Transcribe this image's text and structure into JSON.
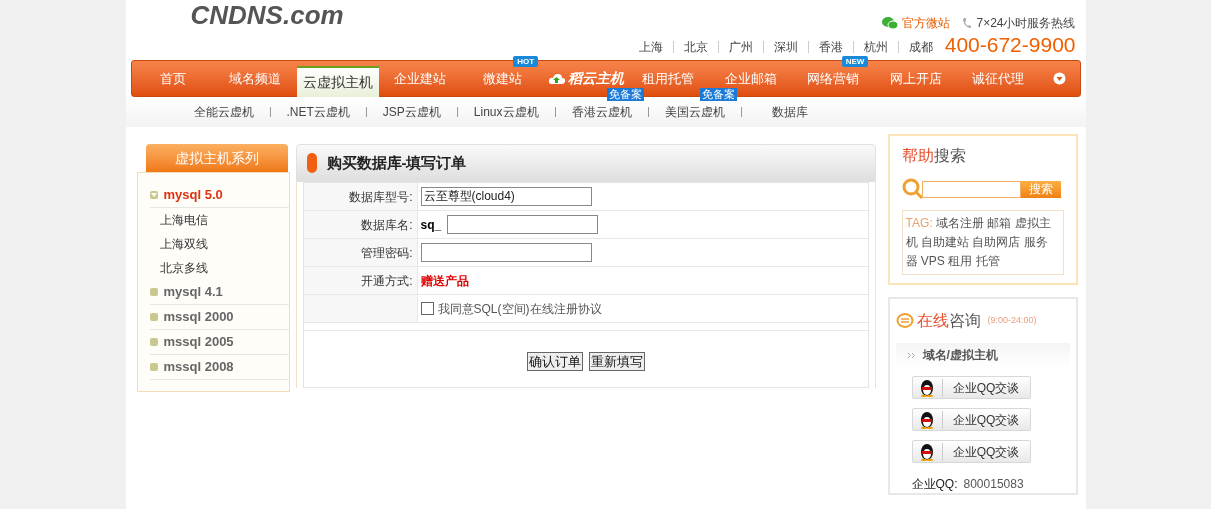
{
  "header": {
    "logo": "CNDNS.com",
    "wechat": "官方微站",
    "hotline": "7×24小时服务热线",
    "cities": [
      "上海",
      "北京",
      "广州",
      "深圳",
      "香港",
      "杭州",
      "成都"
    ],
    "phone": "400-672-9900"
  },
  "nav": [
    {
      "label": "首页",
      "kind": "text",
      "selected": false
    },
    {
      "label": "域名频道",
      "kind": "text",
      "selected": false
    },
    {
      "label": "云虚拟主机",
      "kind": "text",
      "selected": true
    },
    {
      "label": "企业建站",
      "kind": "text",
      "selected": false
    },
    {
      "label": "微建站",
      "kind": "text",
      "selected": false,
      "badge": "HOT"
    },
    {
      "label": "稻云主机",
      "kind": "logo",
      "selected": false
    },
    {
      "label": "租用托管",
      "kind": "text",
      "selected": false
    },
    {
      "label": "企业邮箱",
      "kind": "text",
      "selected": false
    },
    {
      "label": "网络营销",
      "kind": "text",
      "selected": false,
      "badge": "NEW"
    },
    {
      "label": "网上开店",
      "kind": "text",
      "selected": false
    },
    {
      "label": "诚征代理",
      "kind": "text",
      "selected": false
    }
  ],
  "subnav": [
    {
      "label": "全能云虚机"
    },
    {
      "label": ".NET云虚机"
    },
    {
      "label": "JSP云虚机"
    },
    {
      "label": "Linux云虚机"
    },
    {
      "label": "香港云虚机",
      "badge": "免备案"
    },
    {
      "label": "美国云虚机",
      "badge": "免备案"
    },
    {
      "label": "数据库"
    }
  ],
  "sidebar": {
    "title": "虚拟主机系列",
    "items": [
      {
        "label": "mysql 5.0",
        "expanded": true,
        "children": [
          {
            "label": "上海电信"
          },
          {
            "label": "上海双线"
          },
          {
            "label": "北京多线"
          }
        ]
      },
      {
        "label": "mysql 4.1",
        "expanded": false
      },
      {
        "label": "mssql 2000",
        "expanded": false
      },
      {
        "label": "mssql 2005",
        "expanded": false
      },
      {
        "label": "mssql 2008",
        "expanded": false
      }
    ]
  },
  "order": {
    "title": "购买数据库-填写订单",
    "rows": [
      {
        "kind": "input",
        "label": "数据库型号:",
        "value": "云至尊型(cloud4)"
      },
      {
        "kind": "prefixed",
        "label": "数据库名:",
        "prefix": "sq_"
      },
      {
        "kind": "input",
        "label": "管理密码:"
      },
      {
        "kind": "text",
        "label": "开通方式:",
        "value": "赠送产品"
      },
      {
        "kind": "checkbox",
        "label": "我同意SQL(空间)在线注册协议",
        "checked": false
      }
    ],
    "buttons": [
      "确认订单",
      "重新填写"
    ]
  },
  "help": {
    "title_a": "帮助",
    "title_b": "搜索",
    "search_button": "搜索",
    "tag_label": "TAG:",
    "tags": [
      "域名注册",
      "邮箱",
      "虚拟主机",
      "自助建站",
      "自助网店",
      "服务器",
      "VPS",
      "租用",
      "托管"
    ]
  },
  "consult": {
    "title_a": "在线",
    "title_b": "咨询",
    "hours": "(9:00-24:00)",
    "section": "域名/虚拟主机",
    "chat_buttons": [
      "企业QQ交谈",
      "企业QQ交谈",
      "企业QQ交谈"
    ],
    "qq_label": "企业QQ:",
    "qq_number": "800015083"
  }
}
